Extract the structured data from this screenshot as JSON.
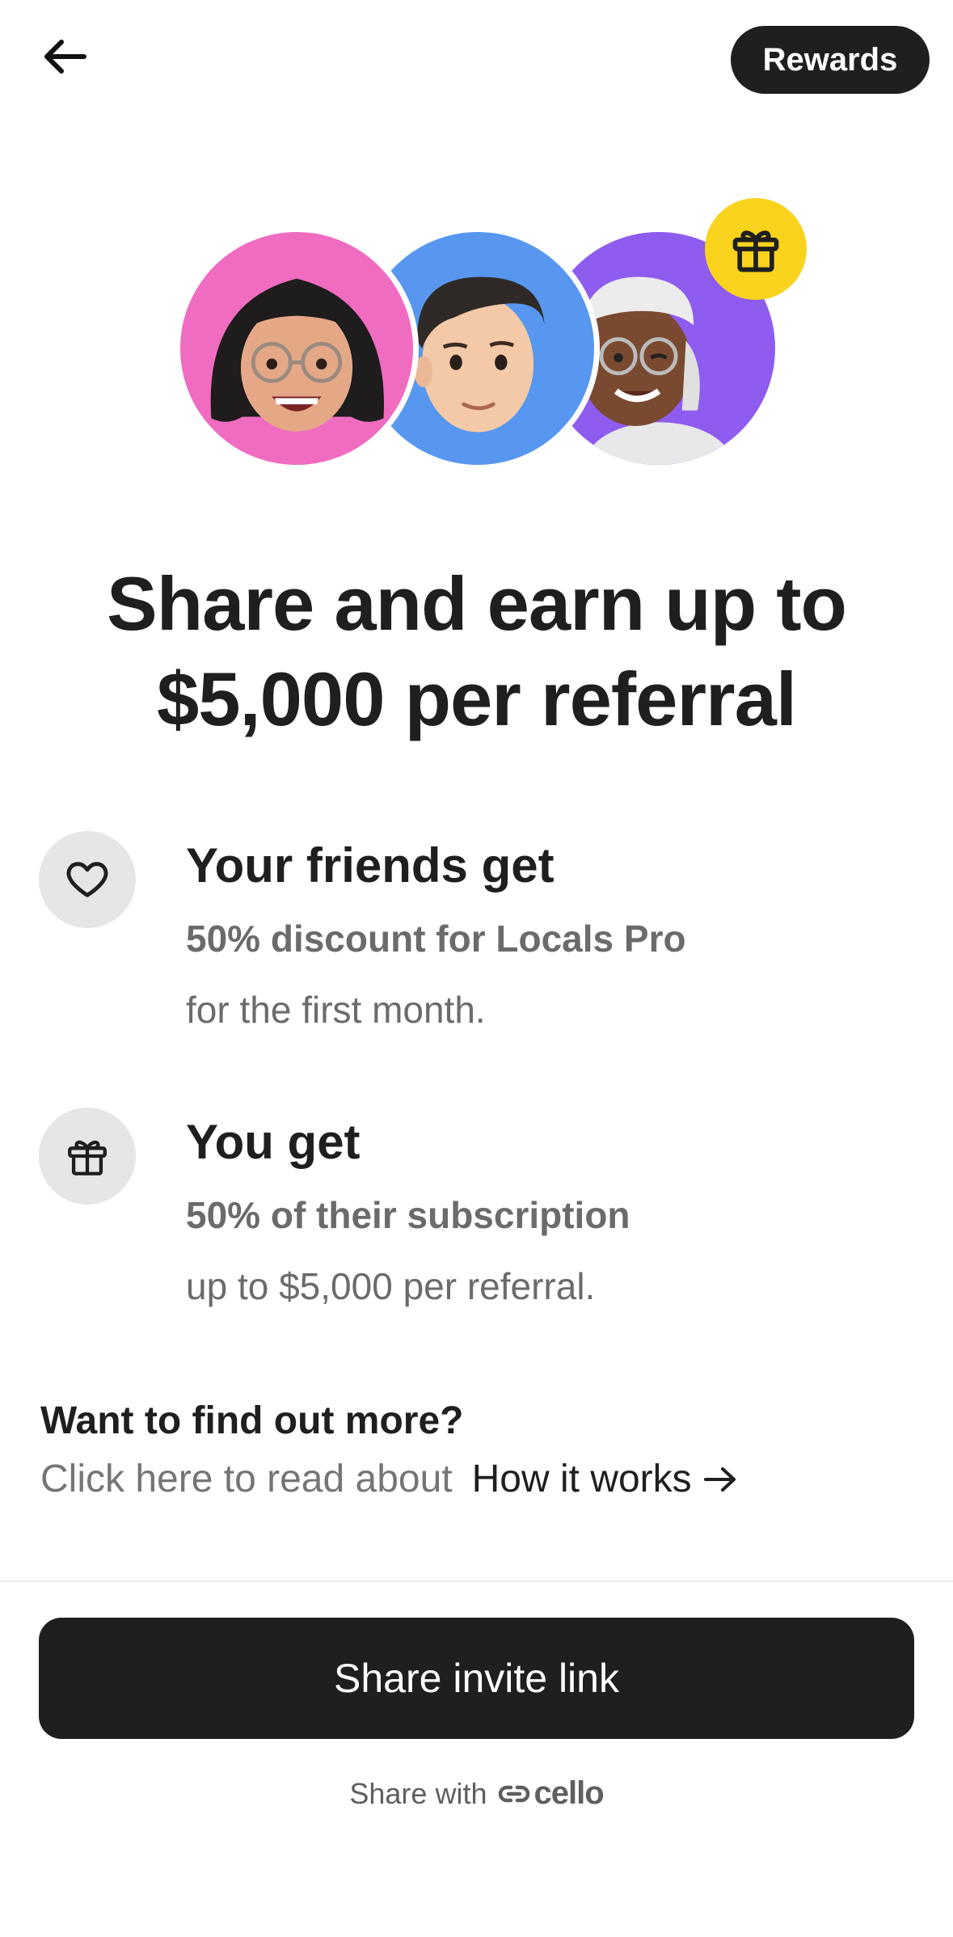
{
  "header": {
    "back_icon": "arrow-left-icon",
    "rewards_label": "Rewards"
  },
  "avatars": {
    "colors": [
      "#ef6cc0",
      "#5797ef",
      "#8f5cf0"
    ],
    "badge_icon": "gift-icon",
    "badge_color": "#f9d31d"
  },
  "headline": "Share and earn up to $5,000 per referral",
  "benefits": [
    {
      "icon": "heart-icon",
      "title": "Your friends get",
      "highlight": "50% discount for Locals Pro",
      "detail": "for the first month."
    },
    {
      "icon": "gift-icon",
      "title": "You get",
      "highlight": "50% of their subscription",
      "detail": "up to $5,000 per referral."
    }
  ],
  "more": {
    "title": "Want to find out more?",
    "text": "Click here to read about",
    "link_label": "How it works",
    "link_icon": "arrow-right-icon"
  },
  "share_button_label": "Share invite link",
  "footer": {
    "share_with": "Share with",
    "brand": "cello",
    "brand_icon": "link-icon"
  }
}
